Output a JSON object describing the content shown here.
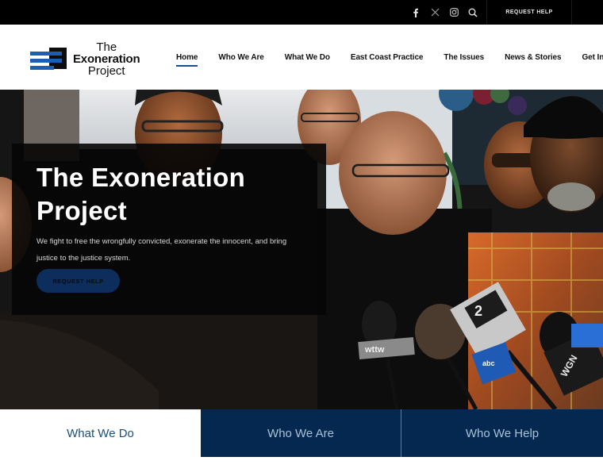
{
  "topbar": {
    "social": [
      {
        "name": "facebook-icon",
        "glyph": "f"
      },
      {
        "name": "x-twitter-icon",
        "glyph": "𝕏"
      },
      {
        "name": "instagram-icon",
        "glyph": ""
      },
      {
        "name": "search-icon",
        "glyph": ""
      }
    ],
    "request_help": "REQUEST HELP"
  },
  "header": {
    "logo": {
      "line1": "The",
      "line2": "Exoneration",
      "line3": "Project"
    },
    "nav": [
      {
        "label": "Home",
        "active": true
      },
      {
        "label": "Who We Are",
        "active": false
      },
      {
        "label": "What We Do",
        "active": false
      },
      {
        "label": "East Coast Practice",
        "active": false
      },
      {
        "label": "The Issues",
        "active": false
      },
      {
        "label": "News & Stories",
        "active": false
      },
      {
        "label": "Get Involved",
        "active": false
      }
    ]
  },
  "hero": {
    "title": "The Exoneration Project",
    "text": "We fight to free the wrongfully convicted, exonerate the innocent, and bring justice to the justice system.",
    "button": "REQUEST HELP",
    "mic_labels": {
      "wttw": "wttw",
      "cbs": "2",
      "abc": "abc",
      "wgn": "WGN"
    }
  },
  "tabs": [
    {
      "label": "What We Do"
    },
    {
      "label": "Who We Are"
    },
    {
      "label": "Who We Help"
    }
  ],
  "colors": {
    "brand_navy": "#04284f",
    "brand_blue": "#1d4f8c",
    "button_navy": "#0d2e5c",
    "tab_text_active": "#1c4f7a",
    "tab_text": "#a9c1d8"
  }
}
